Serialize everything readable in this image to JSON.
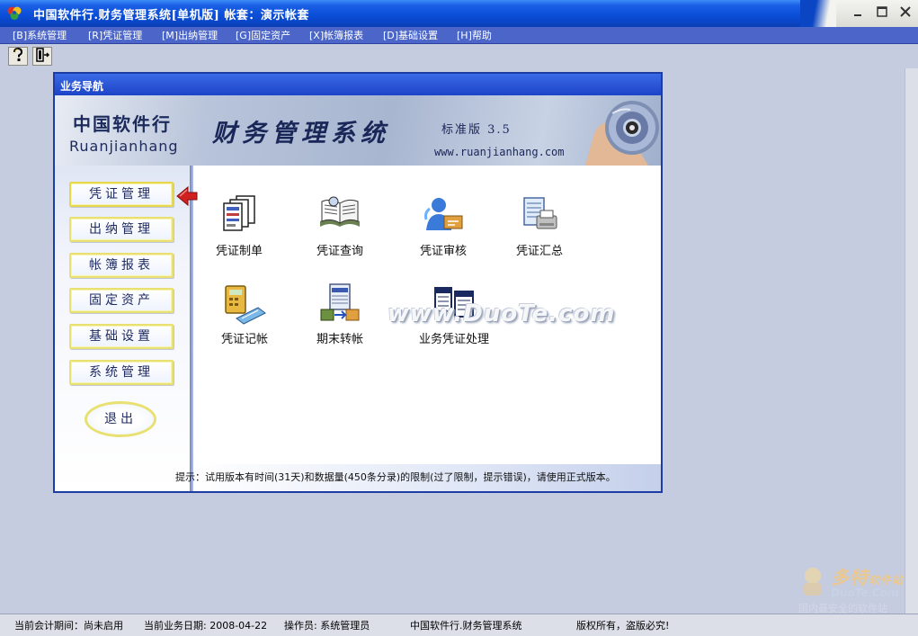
{
  "window": {
    "title": "中国软件行.财务管理系统[单机版]  帐套：演示帐套"
  },
  "menu": [
    {
      "label": "[B]系统管理"
    },
    {
      "label": "[R]凭证管理"
    },
    {
      "label": "[M]出纳管理"
    },
    {
      "label": "[G]固定资产"
    },
    {
      "label": "[X]帐簿报表"
    },
    {
      "label": "[D]基础设置"
    },
    {
      "label": "[H]帮助"
    }
  ],
  "toolbar": {
    "help_icon": "question-help-icon",
    "exit_icon": "door-exit-icon"
  },
  "nav": {
    "header": "业务导航",
    "banner": {
      "brand_cn": "中国软件行",
      "brand_en": "Ruanjianhang",
      "system_name": "财务管理系统",
      "edition": "标准版 3.5",
      "website": "www.ruanjianhang.com"
    },
    "side_buttons": [
      {
        "label": "凭证管理"
      },
      {
        "label": "出纳管理"
      },
      {
        "label": "帐簿报表"
      },
      {
        "label": "固定资产"
      },
      {
        "label": "基础设置"
      },
      {
        "label": "系统管理"
      }
    ],
    "exit_label": "退出",
    "functions": [
      {
        "label": "凭证制单",
        "icon": "voucher-entry-icon"
      },
      {
        "label": "凭证查询",
        "icon": "voucher-query-icon"
      },
      {
        "label": "凭证审核",
        "icon": "voucher-audit-icon"
      },
      {
        "label": "凭证汇总",
        "icon": "voucher-summary-icon"
      },
      {
        "label": "凭证记帐",
        "icon": "voucher-posting-icon"
      },
      {
        "label": "期末转帐",
        "icon": "period-transfer-icon"
      },
      {
        "label": "业务凭证处理",
        "icon": "business-voucher-icon"
      }
    ],
    "watermark": "www.DuoTe.com",
    "hint": "提示：试用版本有时间(31天)和数据量(450条分录)的限制(过了限制，提示错误)，请使用正式版本。"
  },
  "site_mark": {
    "name": "多特",
    "name_small": "软件站",
    "domain": "DuoTe.Com",
    "slogan": "国内最安全的软件站"
  },
  "status": {
    "period": "当前会计期间：尚未启用",
    "date": "当前业务日期: 2008-04-22",
    "operator": "操作员: 系统管理员",
    "product": "中国软件行.财务管理系统",
    "copyright": "版权所有，盗版必究!"
  },
  "colors": {
    "titlebar": "#0b4ed8",
    "menubar": "#4b66c8",
    "desktop": "#c6cce0",
    "panel_border": "#1e3da4",
    "button_border": "#e8e070"
  }
}
